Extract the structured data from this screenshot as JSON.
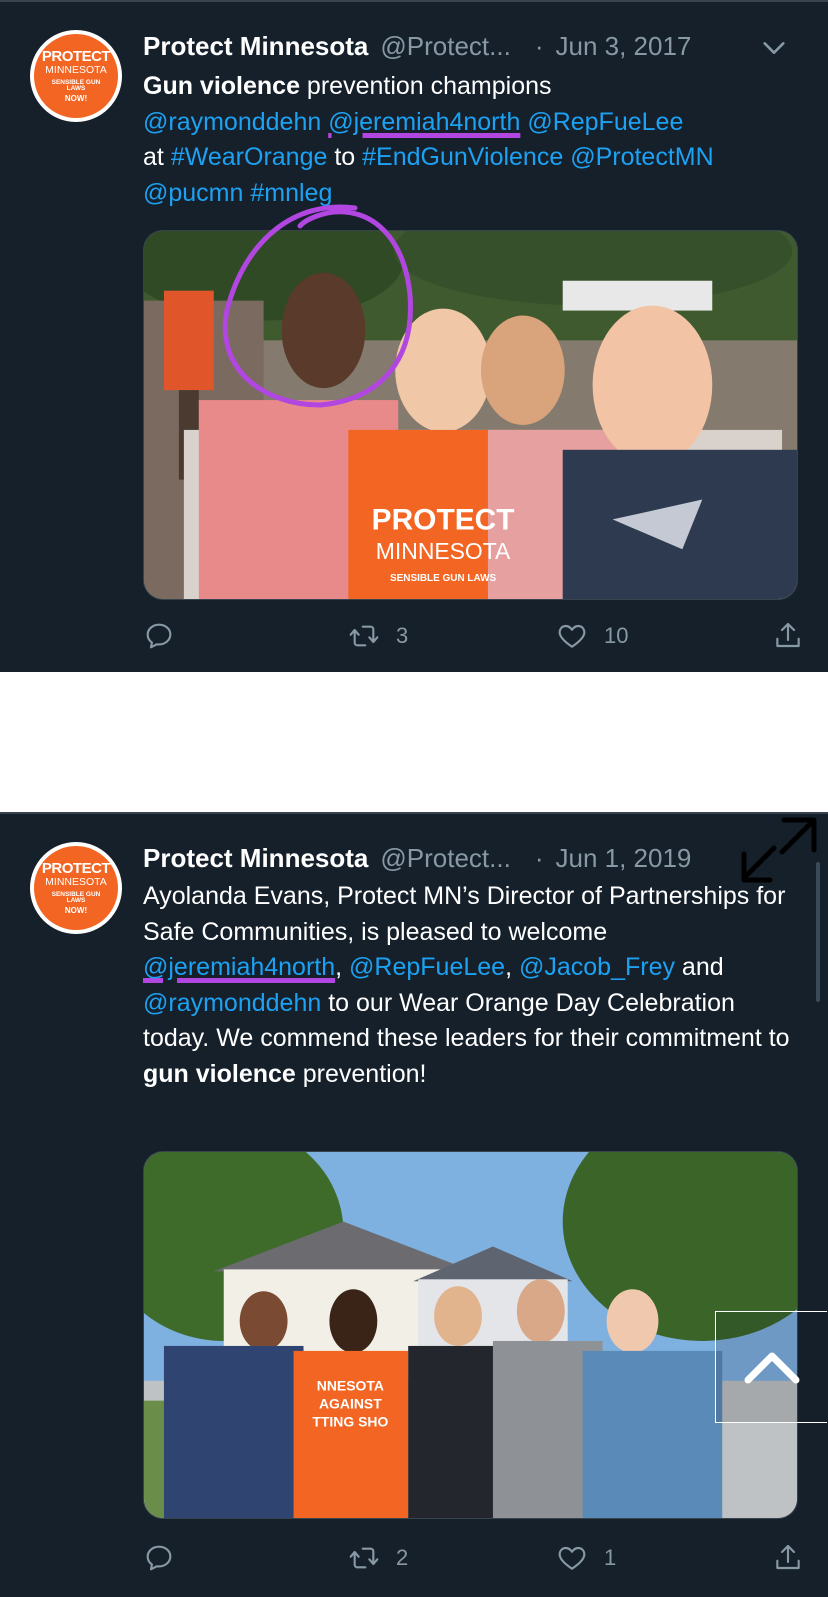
{
  "tweets": [
    {
      "author": {
        "name": "Protect Minnesota",
        "handle": "@Protect...",
        "avatar_text": [
          "PROTECT",
          "MINNESOTA",
          "SENSIBLE GUN LAWS",
          "NOW!"
        ]
      },
      "separator": "·",
      "date": "Jun 3, 2017",
      "text": {
        "line1_bold": "Gun violence",
        "line1_rest": " prevention champions",
        "mention1": "@raymonddehn",
        "mention2": "@jeremiah4north",
        "mention3": "@RepFueLee",
        "word_at": "at",
        "hashtag1": "#WearOrange",
        "word_to": "to",
        "hashtag2": "#EndGunViolence",
        "mention4": "@ProtectMN",
        "mention5": "@pucmn",
        "hashtag3": "#mnleg"
      },
      "media_shirt_text": [
        "PROTECT",
        "MINNESOTA",
        "SENSIBLE GUN LAWS"
      ],
      "stats": {
        "retweets": "3",
        "likes": "10"
      }
    },
    {
      "author": {
        "name": "Protect Minnesota",
        "handle": "@Protect...",
        "avatar_text": [
          "PROTECT",
          "MINNESOTA",
          "SENSIBLE GUN LAWS",
          "NOW!"
        ]
      },
      "separator": "·",
      "date": "Jun 1, 2019",
      "text": {
        "p1": "Ayolanda Evans, Protect MN’s Director of Partnerships for Safe Communities, is pleased to welcome ",
        "mention1": "@jeremiah4north",
        "comma1": ", ",
        "mention2": "@RepFueLee",
        "comma2": ", ",
        "mention3": "@Jacob_Frey",
        "and": " and ",
        "mention4": "@raymonddehn",
        "p2": " to our Wear Orange Day Celebration today. We commend these leaders for their commitment to ",
        "bold": "gun violence",
        "p3": " prevention!"
      },
      "media_shirt_text": [
        "NNESOTA",
        "AGAINST",
        "TTING SHO"
      ],
      "stats": {
        "retweets": "2",
        "likes": "1"
      }
    }
  ],
  "icons": [
    "reply-icon",
    "retweet-icon",
    "like-icon",
    "share-icon",
    "chevron-down-icon",
    "expand-icon",
    "scroll-top-icon"
  ],
  "colors": {
    "background": "#15202b",
    "link": "#1da1f2",
    "muted": "#8899a6",
    "brand_orange": "#f26522",
    "annotation_purple": "#b146e0"
  }
}
